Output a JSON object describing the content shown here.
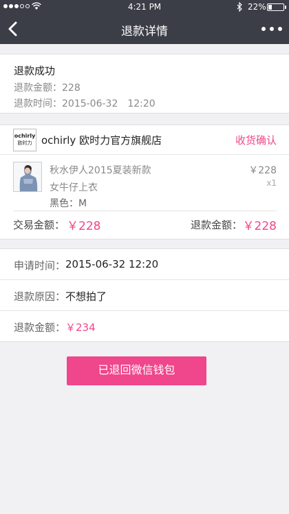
{
  "status_bar": {
    "time": "4:21 PM",
    "battery_percent": "22%",
    "battery_level": 0.22,
    "signal_bars_filled": 3,
    "signal_bars_total": 5
  },
  "nav": {
    "title": "退款详情",
    "back_icon": "chevron-left-icon",
    "more_icon": "more-dots-icon"
  },
  "refund_status": {
    "headline": "退款成功",
    "amount_line": "退款金额：228",
    "time_line": "退款时间：2015-06-32　12:20"
  },
  "order": {
    "shop_logo_brand": "ochirly",
    "shop_logo_cn": "欧时力",
    "shop_name": "ochirly 欧时力官方旗舰店",
    "shop_action": "收货确认",
    "product": {
      "name_line1": "秋水伊人2015夏装新款",
      "name_line2": "女牛仔上衣",
      "spec": "黑色：M",
      "price": "￥228",
      "qty": "x1"
    },
    "trade_amount_label": "交易金额：",
    "trade_amount_value": "￥228",
    "refund_amount_label": "退款金额：",
    "refund_amount_value": "￥228"
  },
  "details": {
    "apply_time_label": "申请时间：",
    "apply_time_value": "2015-06-32 12:20",
    "reason_label": "退款原因：",
    "reason_value": "不想拍了",
    "refund_amount_label": "退款金额：",
    "refund_amount_value": "￥234"
  },
  "action_button": "已退回微信钱包",
  "colors": {
    "accent": "#f0468b",
    "nav_bg": "#3b3d47",
    "page_bg": "#f1f1f3"
  }
}
